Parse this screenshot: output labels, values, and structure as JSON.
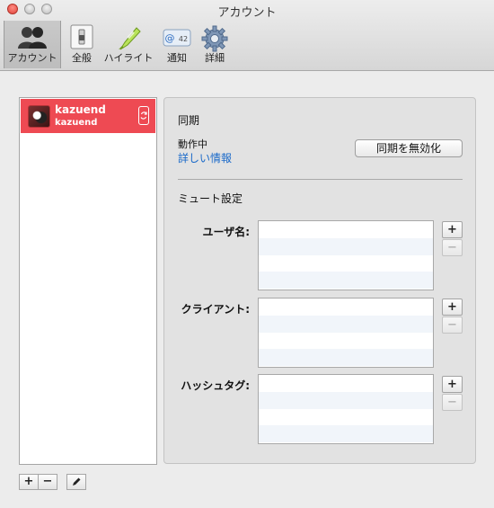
{
  "window": {
    "title": "アカウント"
  },
  "toolbar": {
    "items": [
      {
        "label": "アカウント",
        "icon": "users-icon",
        "selected": true
      },
      {
        "label": "全般",
        "icon": "switch-icon"
      },
      {
        "label": "ハイライト",
        "icon": "highlighter-icon"
      },
      {
        "label": "通知",
        "icon": "notification-icon",
        "badge": "42",
        "at": "@"
      },
      {
        "label": "詳細",
        "icon": "gear-icon"
      }
    ]
  },
  "accounts": {
    "items": [
      {
        "name": "kazuend",
        "subtitle": "kazuend",
        "selected": true
      }
    ],
    "add_label": "+",
    "remove_label": "−",
    "edit_icon": "pencil-icon"
  },
  "sync": {
    "section_title": "同期",
    "status": "動作中",
    "details_link": "詳しい情報",
    "disable_button": "同期を無効化"
  },
  "mute": {
    "section_title": "ミュート設定",
    "fields": [
      {
        "label": "ユーザ名:",
        "add": "+",
        "remove": "−"
      },
      {
        "label": "クライアント:",
        "add": "+",
        "remove": "−"
      },
      {
        "label": "ハッシュタグ:",
        "add": "+",
        "remove": "−"
      }
    ]
  },
  "colors": {
    "selection": "#ee4a53",
    "link": "#1b6ac9"
  }
}
